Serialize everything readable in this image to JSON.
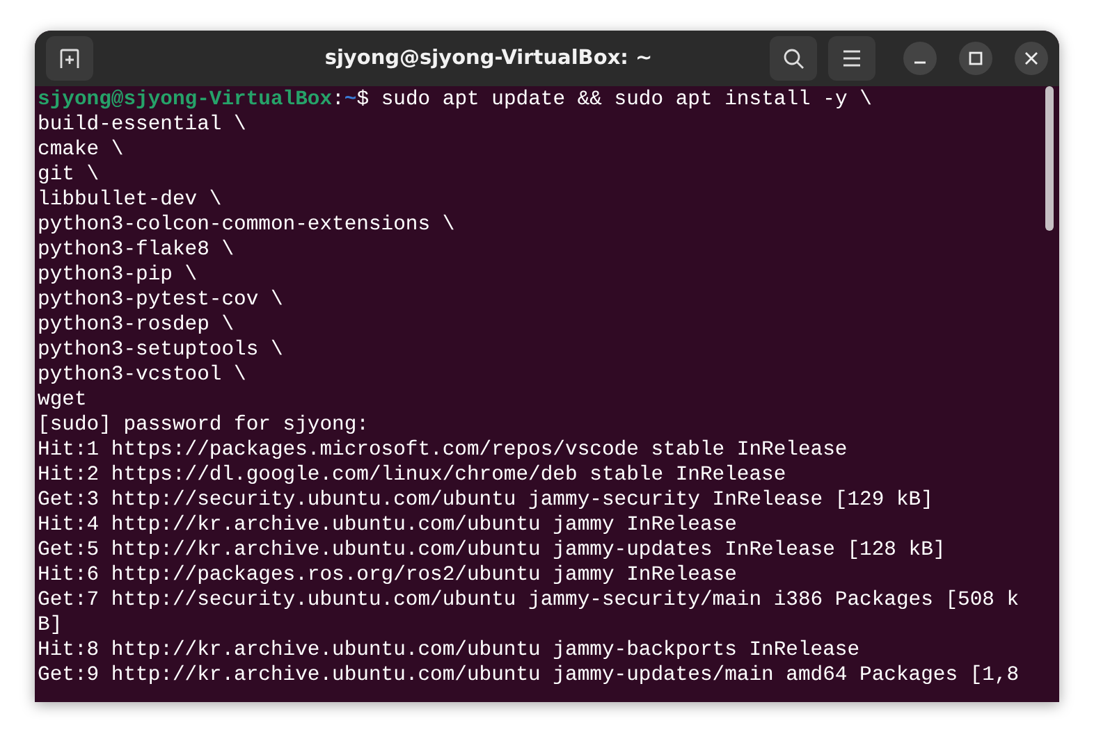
{
  "window": {
    "title": "sjyong@sjyong-VirtualBox: ~"
  },
  "terminal": {
    "prompt": {
      "user_host": "sjyong@sjyong-VirtualBox",
      "separator": ":",
      "path": "~",
      "command": "$ sudo apt update && sudo apt install -y \\"
    },
    "lines": [
      "build-essential \\",
      "cmake \\",
      "git \\",
      "libbullet-dev \\",
      "python3-colcon-common-extensions \\",
      "python3-flake8 \\",
      "python3-pip \\",
      "python3-pytest-cov \\",
      "python3-rosdep \\",
      "python3-setuptools \\",
      "python3-vcstool \\",
      "wget",
      "[sudo] password for sjyong:",
      "Hit:1 https://packages.microsoft.com/repos/vscode stable InRelease",
      "Hit:2 https://dl.google.com/linux/chrome/deb stable InRelease",
      "Get:3 http://security.ubuntu.com/ubuntu jammy-security InRelease [129 kB]",
      "Hit:4 http://kr.archive.ubuntu.com/ubuntu jammy InRelease",
      "Get:5 http://kr.archive.ubuntu.com/ubuntu jammy-updates InRelease [128 kB]",
      "Hit:6 http://packages.ros.org/ros2/ubuntu jammy InRelease",
      "Get:7 http://security.ubuntu.com/ubuntu jammy-security/main i386 Packages [508 k",
      "B]",
      "Hit:8 http://kr.archive.ubuntu.com/ubuntu jammy-backports InRelease",
      "Get:9 http://kr.archive.ubuntu.com/ubuntu jammy-updates/main amd64 Packages [1,8"
    ]
  }
}
